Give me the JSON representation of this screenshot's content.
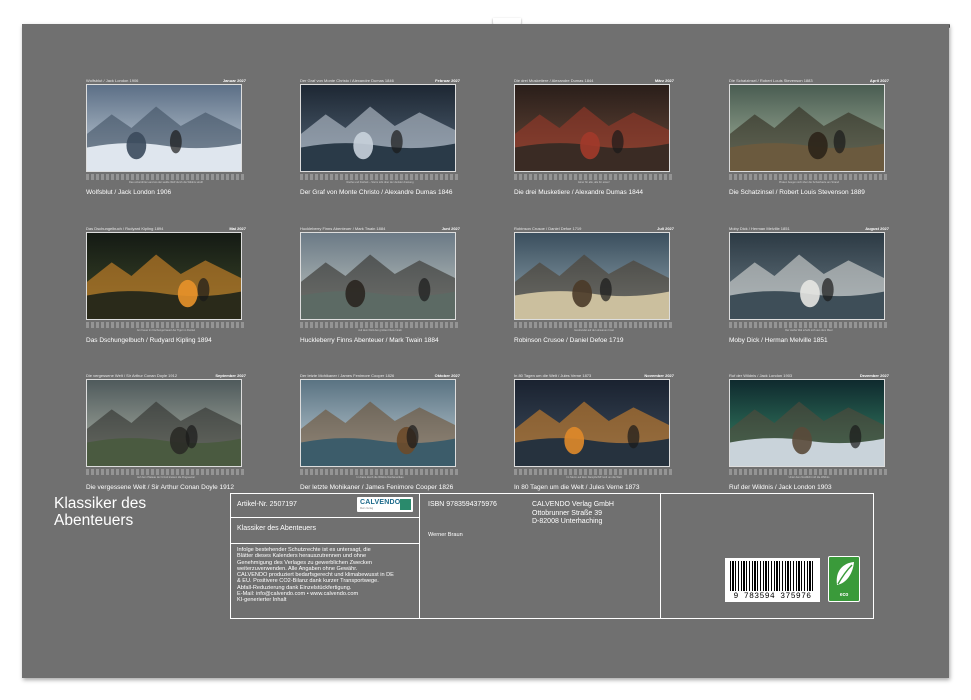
{
  "calendar": {
    "title": "Klassiker des Abenteuers",
    "months": [
      {
        "small_left": "Wolfsblut / Jack London 1906",
        "month": "Januar 2027",
        "label": "Wolfsblut / Jack London 1906",
        "caption": "Das unberührte Land wo der weiße Wolf durch die Wildnis streift"
      },
      {
        "small_left": "Der Graf von Monte Christo / Alexandre Dumas 1846",
        "month": "Februar 2027",
        "label": "Der Graf von Monte Christo / Alexandre Dumas 1846",
        "caption": "Rache und Freiheit – Sturm tobt über der dunklen Festung"
      },
      {
        "small_left": "Die drei Musketiere / Alexandre Dumas 1844",
        "month": "März 2027",
        "label": "Die drei Musketiere / Alexandre Dumas 1844",
        "caption": "Einer für alle, alle für einen!"
      },
      {
        "small_left": "Die Schatzinsel / Robert Louis Stevenson 1883",
        "month": "April 2027",
        "label": "Die Schatzinsel / Robert Louis Stevenson 1889",
        "caption": "Piraten beugen sich über die Schatzkarte am Strand"
      },
      {
        "small_left": "Das Dschungelbuch / Rudyard Kipling 1894",
        "month": "Mai 2027",
        "label": "Das Dschungelbuch / Rudyard Kipling 1894",
        "caption": "Am Feuer im Dschungel lauert der Tiger im Dunkel"
      },
      {
        "small_left": "Huckleberry Finns Abenteuer / Mark Twain 1884",
        "month": "Juni 2027",
        "label": "Huckleberry Finns Abenteuer / Mark Twain 1884",
        "caption": "Auf dem Floß den großen Fluss hinab"
      },
      {
        "small_left": "Robinson Crusoe / Daniel Defoe 1719",
        "month": "Juli 2027",
        "label": "Robinson Crusoe / Daniel Defoe 1719",
        "caption": "Gestrandet auf der einsamen Insel"
      },
      {
        "small_left": "Moby Dick / Herman Melville 1851",
        "month": "August 2027",
        "label": "Moby Dick / Herman Melville 1851",
        "caption": "Der weiße Wal erhebt sich aus dem Meer"
      },
      {
        "small_left": "Die vergessene Welt / Sir Arthur Conan Doyle 1912",
        "month": "September 2027",
        "label": "Die vergessene Welt / Sir Arthur Conan Doyle 1912",
        "caption": "Auf dem Plateau der Urzeit kreisen die Flugsaurier"
      },
      {
        "small_left": "Der letzte Mohikaner / James Fenimore Cooper 1826",
        "month": "Oktober 2027",
        "label": "Der letzte Mohikaner / James Fenimore Cooper 1826",
        "caption": "Im Kanu durch die Wildnis Nordamerikas"
      },
      {
        "small_left": "In 80 Tagen um die Welt / Jules Verne 1873",
        "month": "November 2027",
        "label": "In 80 Tagen um die Welt / Jules Verne 1873",
        "caption": "Im Sturm auf dem Dampfschiff rund um die Welt"
      },
      {
        "small_left": "Ruf der Wildnis / Jack London 1903",
        "month": "Dezember 2027",
        "label": "Ruf der Wildnis / Jack London 1903",
        "caption": "Unter dem Nordlicht ruft die Wildnis"
      }
    ]
  },
  "info": {
    "article": "Artikel-Nr. 2507197",
    "isbn": "ISBN 9783594375976",
    "publisher_line1": "CALVENDO Verlag GmbH",
    "publisher_line2": "Ottobrunner Straße 39",
    "publisher_line3": "D-82008 Unterhaching",
    "product_title": "Klassiker des Abenteuers",
    "author": "Werner Braun",
    "legal_1": "Infolge bestehender Schutzrechte ist es untersagt, die",
    "legal_2": "Blätter dieses Kalenders herauszutrennen und ohne",
    "legal_3": "Genehmigung des Verlages zu gewerblichen Zwecken",
    "legal_4": "weiterzuverwenden. Alle Angaben ohne Gewähr.",
    "legal_5": "CALVENDO produziert bedarfsgerecht und klimabewusst in DE",
    "legal_6": "& EU. Positivere CO2-Bilanz dank kurzer Transportwege.",
    "legal_7": "Abfall-Reduzierung dank Einzelstückfertigung.",
    "legal_8": "E-Mail: info@calvendo.com • www.calvendo.com",
    "legal_9": "KI-generierter Inhalt",
    "logo_text": "CALVENDO",
    "logo_sub": "Mein Verlag",
    "barcode_number": "9 783594 375976",
    "eco_label": "eco"
  }
}
